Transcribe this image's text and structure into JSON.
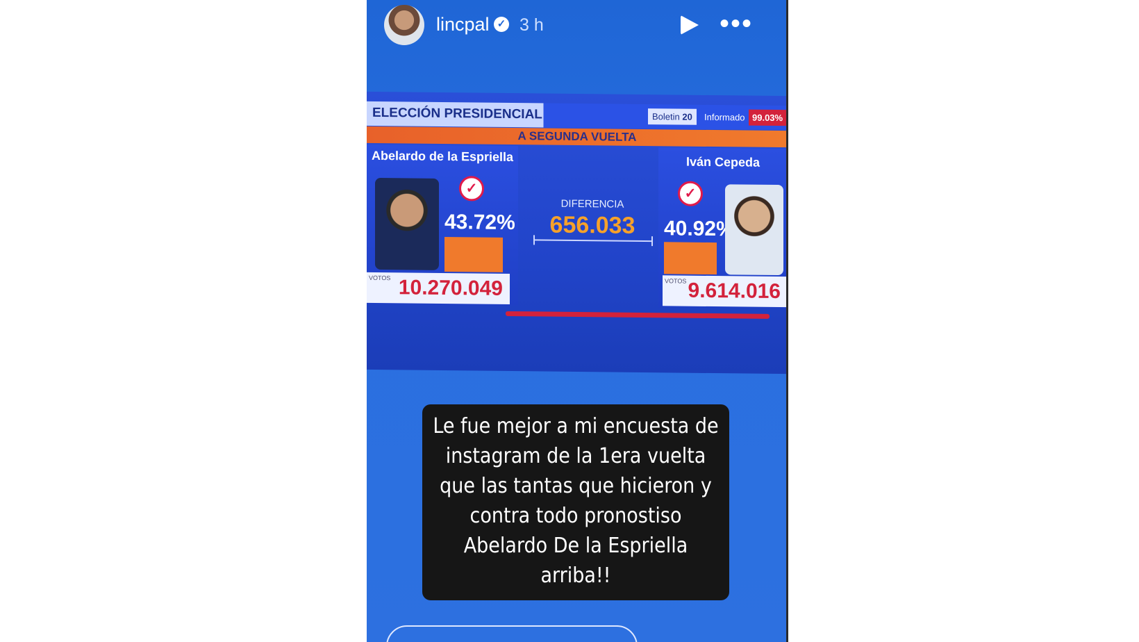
{
  "story": {
    "username": "lincpal",
    "time": "3 h",
    "verified_icon": "verified-badge-icon",
    "controls": {
      "play_icon": "play-icon",
      "more_icon": "more-options-icon"
    }
  },
  "broadcast": {
    "title": "ELECCIÓN PRESIDENCIAL",
    "boletin_label": "Boletin",
    "boletin_number": "20",
    "informado_label": "Informado",
    "informado_pct": "99.03%",
    "banner": "A SEGUNDA VUELTA",
    "left_candidate": {
      "name": "Abelardo de la Espriella",
      "percent": "43.72%",
      "votes_label": "VOTOS",
      "votes": "10.270.049",
      "percent_value": 43.72
    },
    "right_candidate": {
      "name": "Iván Cepeda",
      "percent": "40.92%",
      "votes_label": "VOTOS",
      "votes": "9.614.016",
      "percent_value": 40.92
    },
    "difference_label": "DIFERENCIA",
    "difference": "656.033"
  },
  "caption": "Le fue mejor a mi encuesta de instagram de la 1era vuelta que las tantas que hicieron y contra todo pronostiso Abelardo De la Espriella arriba!!",
  "colors": {
    "background": "#2a6fe0",
    "accent_orange": "#f07a2c",
    "accent_red": "#d3223b"
  }
}
